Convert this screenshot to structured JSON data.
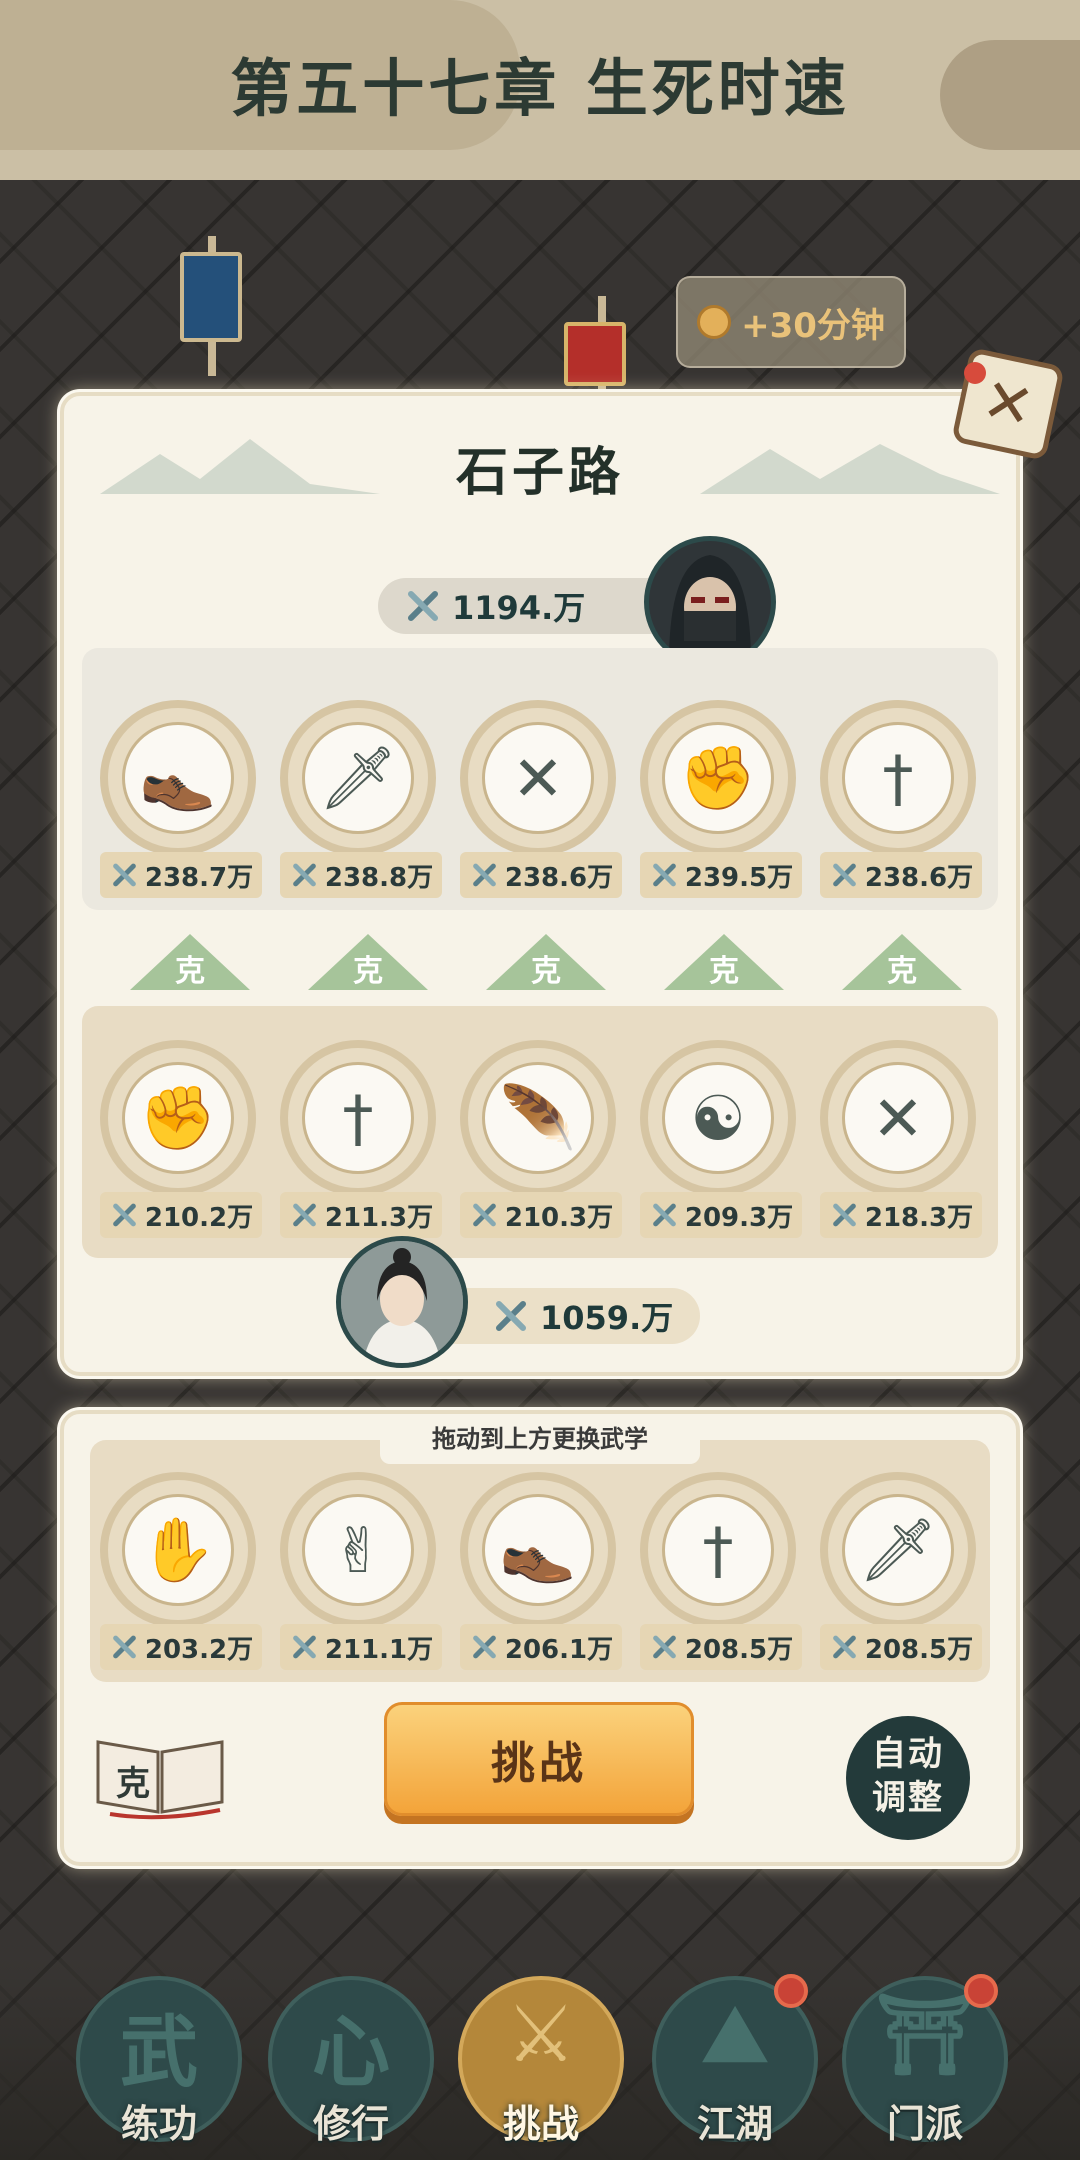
{
  "header": {
    "chapter_title": "第五十七章 生死时速"
  },
  "timer": {
    "label": "+30分钟",
    "icon": "coin-icon"
  },
  "stage": {
    "title": "石子路",
    "close_icon": "close-scroll-icon"
  },
  "enemy": {
    "total_power": "1194.万",
    "avatar": "hooded-assassin-avatar"
  },
  "enemy_skills": [
    {
      "icon": "shoe-icon",
      "glyph": "👞",
      "power": "238.7万"
    },
    {
      "icon": "throwing-knives-icon",
      "glyph": "🗡",
      "power": "238.8万"
    },
    {
      "icon": "crossed-spears-icon",
      "glyph": "✕",
      "power": "238.6万"
    },
    {
      "icon": "fist-icon",
      "glyph": "✊",
      "power": "239.5万"
    },
    {
      "icon": "sword-icon",
      "glyph": "†",
      "power": "238.6万"
    }
  ],
  "counter_label": "克",
  "player_skills": [
    {
      "icon": "fist-icon",
      "glyph": "✊",
      "power": "210.2万"
    },
    {
      "icon": "saber-icon",
      "glyph": "†",
      "power": "211.3万"
    },
    {
      "icon": "feather-icon",
      "glyph": "🪶",
      "power": "210.3万"
    },
    {
      "icon": "meditation-icon",
      "glyph": "☯",
      "power": "209.3万"
    },
    {
      "icon": "crossed-spears-icon",
      "glyph": "✕",
      "power": "218.3万"
    }
  ],
  "player": {
    "total_power": "1059.万",
    "avatar": "swordsman-avatar"
  },
  "inventory": {
    "drag_hint": "拖动到上方更换武学",
    "skills": [
      {
        "icon": "palm-icon",
        "glyph": "✋",
        "power": "203.2万"
      },
      {
        "icon": "two-finger-icon",
        "glyph": "✌",
        "power": "211.1万"
      },
      {
        "icon": "shoe-icon",
        "glyph": "👞",
        "power": "206.1万"
      },
      {
        "icon": "sword-icon",
        "glyph": "†",
        "power": "208.5万"
      },
      {
        "icon": "throwing-knives-icon",
        "glyph": "🗡",
        "power": "208.5万"
      }
    ]
  },
  "actions": {
    "challenge": "挑战",
    "auto_adjust_line1": "自动",
    "auto_adjust_line2": "调整",
    "manual_icon": "counter-manual-book-icon",
    "book_char": "克"
  },
  "nav": [
    {
      "label": "练功",
      "glyph": "武",
      "icon": "training-icon",
      "active": false,
      "badge": false
    },
    {
      "label": "修行",
      "glyph": "心",
      "icon": "heart-mind-icon",
      "active": false,
      "badge": false
    },
    {
      "label": "挑战",
      "glyph": "⚔",
      "icon": "crossed-swords-icon",
      "active": true,
      "badge": false
    },
    {
      "label": "江湖",
      "glyph": "⛰",
      "icon": "mountain-icon",
      "active": false,
      "badge": true
    },
    {
      "label": "门派",
      "glyph": "⛩",
      "icon": "gate-icon",
      "active": false,
      "badge": true
    }
  ],
  "colors": {
    "accent_orange": "#f3a43a",
    "panel_cream": "#f7f3e8",
    "nav_teal": "#2e4a4a",
    "badge_red": "#c94336"
  }
}
